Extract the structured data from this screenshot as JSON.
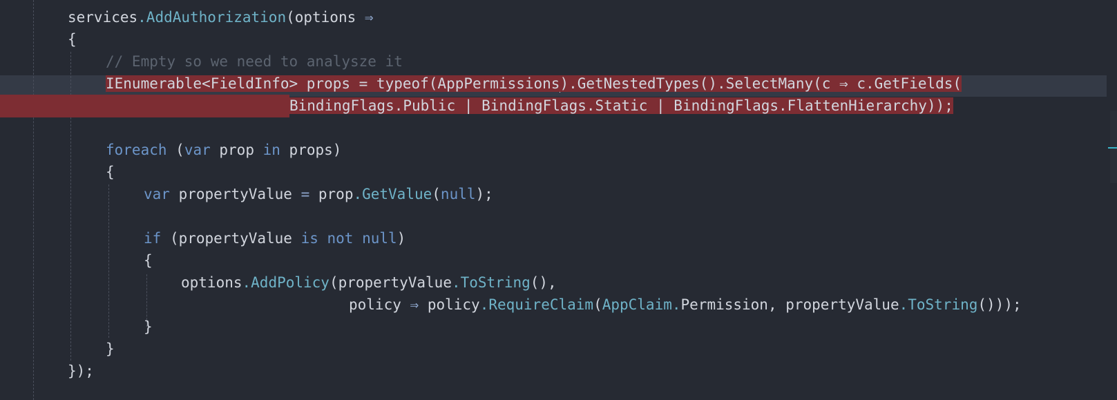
{
  "editor": {
    "language": "C#",
    "lines": [
      {
        "tokens": [
          {
            "t": "services",
            "c": "plain"
          },
          {
            "t": ".AddAuthorization",
            "c": "method"
          },
          {
            "t": "(options ",
            "c": "plain"
          },
          {
            "t": "⇒",
            "c": "arrow"
          }
        ]
      },
      {
        "tokens": [
          {
            "t": "{",
            "c": "plain"
          }
        ]
      },
      {
        "tokens": [
          {
            "t": "// Empty so we need to analysze it",
            "c": "comment"
          }
        ]
      },
      {
        "tokens": [
          {
            "t": "IEnumerable<FieldInfo> props = typeof(AppPermissions",
            "c": "plain",
            "hl": true
          },
          {
            "t": "caret",
            "c": "caret"
          },
          {
            "t": ").GetNestedTypes().SelectMany(c ⇒ c.GetFields(",
            "c": "plain",
            "hl": true
          }
        ]
      },
      {
        "tokens": [
          {
            "t": "BindingFlags.Public | BindingFlags.Static | BindingFlags.FlattenHierarchy));",
            "c": "plain",
            "hl": true
          }
        ]
      },
      {
        "tokens": []
      },
      {
        "tokens": [
          {
            "t": "foreach",
            "c": "keyword"
          },
          {
            "t": " (",
            "c": "plain"
          },
          {
            "t": "var",
            "c": "keyword"
          },
          {
            "t": " prop ",
            "c": "plain"
          },
          {
            "t": "in",
            "c": "keyword"
          },
          {
            "t": " props)",
            "c": "plain"
          }
        ]
      },
      {
        "tokens": [
          {
            "t": "{",
            "c": "plain"
          }
        ]
      },
      {
        "tokens": [
          {
            "t": "var",
            "c": "keyword"
          },
          {
            "t": " propertyValue ",
            "c": "plain"
          },
          {
            "t": "=",
            "c": "arrow"
          },
          {
            "t": " prop",
            "c": "plain"
          },
          {
            "t": ".GetValue",
            "c": "method"
          },
          {
            "t": "(",
            "c": "plain"
          },
          {
            "t": "null",
            "c": "keyword"
          },
          {
            "t": ");",
            "c": "plain"
          }
        ]
      },
      {
        "tokens": []
      },
      {
        "tokens": [
          {
            "t": "if",
            "c": "keyword"
          },
          {
            "t": " (propertyValue ",
            "c": "plain"
          },
          {
            "t": "is not null",
            "c": "keyword"
          },
          {
            "t": ")",
            "c": "plain"
          }
        ]
      },
      {
        "tokens": [
          {
            "t": "{",
            "c": "plain"
          }
        ]
      },
      {
        "tokens": [
          {
            "t": "options",
            "c": "plain"
          },
          {
            "t": ".AddPolicy",
            "c": "method"
          },
          {
            "t": "(propertyValue",
            "c": "plain"
          },
          {
            "t": ".ToString",
            "c": "method"
          },
          {
            "t": "(),",
            "c": "plain"
          }
        ]
      },
      {
        "tokens": [
          {
            "t": "policy ",
            "c": "plain"
          },
          {
            "t": "⇒",
            "c": "arrow"
          },
          {
            "t": " policy",
            "c": "plain"
          },
          {
            "t": ".RequireClaim",
            "c": "method"
          },
          {
            "t": "(",
            "c": "plain"
          },
          {
            "t": "AppClaim.",
            "c": "type"
          },
          {
            "t": "Permission, propertyValue",
            "c": "plain"
          },
          {
            "t": ".ToString",
            "c": "method"
          },
          {
            "t": "()));",
            "c": "plain"
          }
        ]
      },
      {
        "tokens": [
          {
            "t": "}",
            "c": "plain"
          }
        ]
      },
      {
        "tokens": [
          {
            "t": "}",
            "c": "plain"
          }
        ]
      },
      {
        "tokens": [
          {
            "t": "});",
            "c": "plain"
          }
        ]
      }
    ]
  },
  "colors": {
    "background": "#262a33",
    "current_line": "#343a46",
    "error_highlight": "#7d2d33",
    "comment": "#5c6470",
    "keyword": "#6c95c9",
    "method": "#6fb3c8",
    "text": "#d2d6de"
  }
}
